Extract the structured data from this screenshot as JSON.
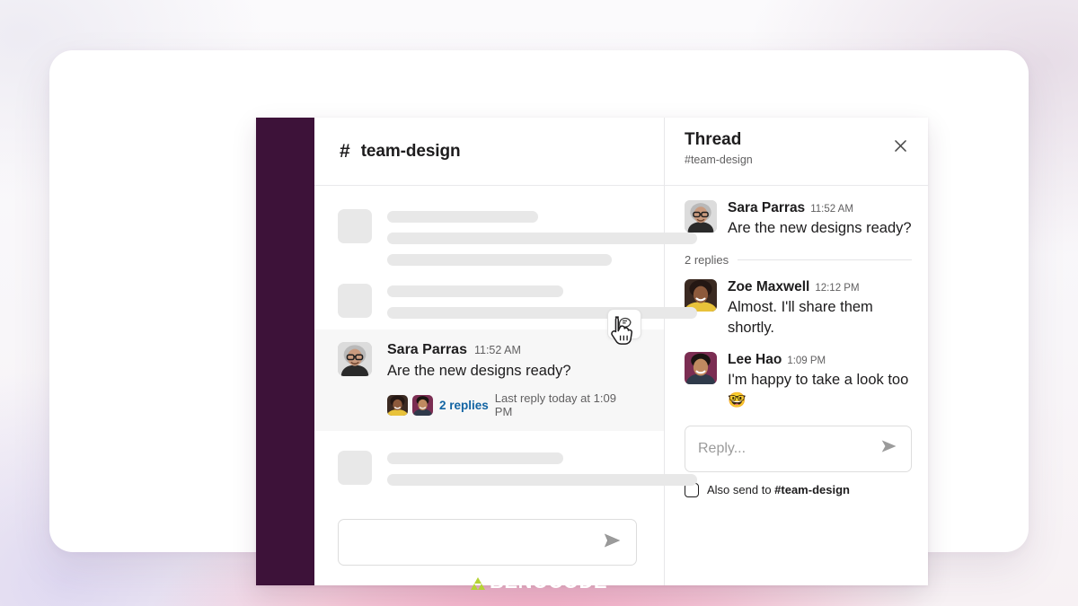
{
  "brand": {
    "logo_text": "BENOCODE",
    "logo_mark_color": "#b5d334",
    "sidebar_color": "#3d1239",
    "link_color": "#1264a3"
  },
  "channel": {
    "hash": "#",
    "name": "team-design",
    "skeleton_rows": [
      {
        "lines": [
          168,
          345,
          250
        ]
      },
      {
        "lines": [
          196,
          345
        ]
      }
    ],
    "skeleton_rows_bottom": [
      {
        "lines": [
          196,
          345
        ]
      }
    ],
    "message": {
      "author": "Sara Parras",
      "time": "11:52 AM",
      "text": "Are the new designs ready?",
      "replies_link": "2 replies",
      "replies_meta": "Last reply today at 1:09 PM",
      "hover_action_icon": "thread-comment-icon"
    },
    "composer": {
      "placeholder": "",
      "send_icon": "send-icon"
    }
  },
  "thread": {
    "title": "Thread",
    "subtitle": "#team-design",
    "close_icon": "close-icon",
    "root_message": {
      "author": "Sara Parras",
      "time": "11:52 AM",
      "text": "Are the new designs ready?"
    },
    "replies_count": "2 replies",
    "replies": [
      {
        "author": "Zoe Maxwell",
        "time": "12:12 PM",
        "text": "Almost. I'll share them shortly."
      },
      {
        "author": "Lee Hao",
        "time": "1:09 PM",
        "text": "I'm happy to take a look too 🤓"
      }
    ],
    "reply_input": {
      "placeholder": "Reply...",
      "send_icon": "send-icon"
    },
    "also_send": {
      "prefix": "Also send to ",
      "channel": "#team-design",
      "checked": false
    }
  }
}
